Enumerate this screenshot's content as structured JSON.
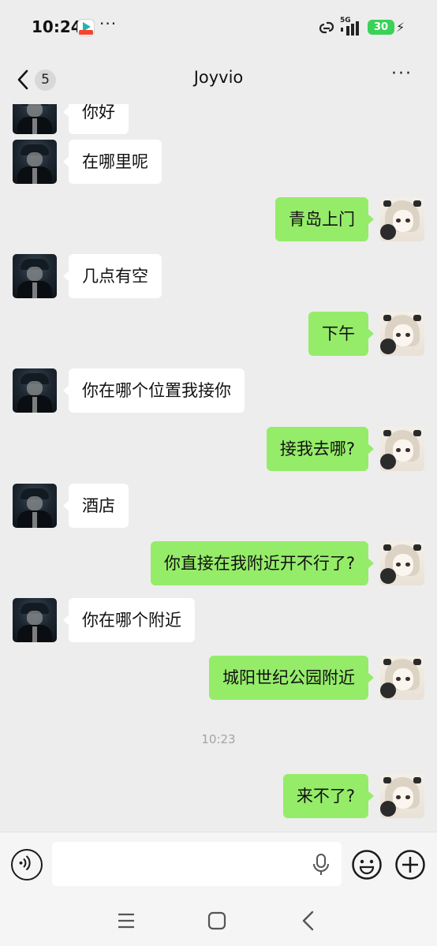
{
  "status_bar": {
    "time": "10:24",
    "more": "···",
    "network": "5G",
    "battery": "30",
    "icons": [
      "app-icon",
      "link-icon",
      "signal-icon",
      "battery-icon",
      "charging-icon"
    ]
  },
  "nav": {
    "back_icon": "chevron-left-icon",
    "unread_count": "5",
    "title": "Joyvio",
    "more": "···"
  },
  "messages": [
    {
      "side": "left",
      "text": "你好"
    },
    {
      "side": "left",
      "text": "在哪里呢"
    },
    {
      "side": "right",
      "text": "青岛上门"
    },
    {
      "side": "left",
      "text": "几点有空"
    },
    {
      "side": "right",
      "text": "下午"
    },
    {
      "side": "left",
      "text": "你在哪个位置我接你"
    },
    {
      "side": "right",
      "text": "接我去哪?"
    },
    {
      "side": "left",
      "text": "酒店"
    },
    {
      "side": "right",
      "text": "你直接在我附近开不行了?"
    },
    {
      "side": "left",
      "text": "你在哪个附近"
    },
    {
      "side": "right",
      "text": "城阳世纪公园附近"
    },
    {
      "side": "time",
      "text": "10:23"
    },
    {
      "side": "right",
      "text": "来不了?"
    }
  ],
  "input_bar": {
    "value": "",
    "icons": [
      "voice-icon",
      "mic-icon",
      "emoji-icon",
      "plus-icon"
    ]
  },
  "system_nav": {
    "icons": [
      "menu-icon",
      "home-icon",
      "back-icon"
    ]
  },
  "colors": {
    "background": "#ededed",
    "bubble_sent": "#95ec69",
    "bubble_received": "#ffffff",
    "battery": "#3ad157"
  }
}
